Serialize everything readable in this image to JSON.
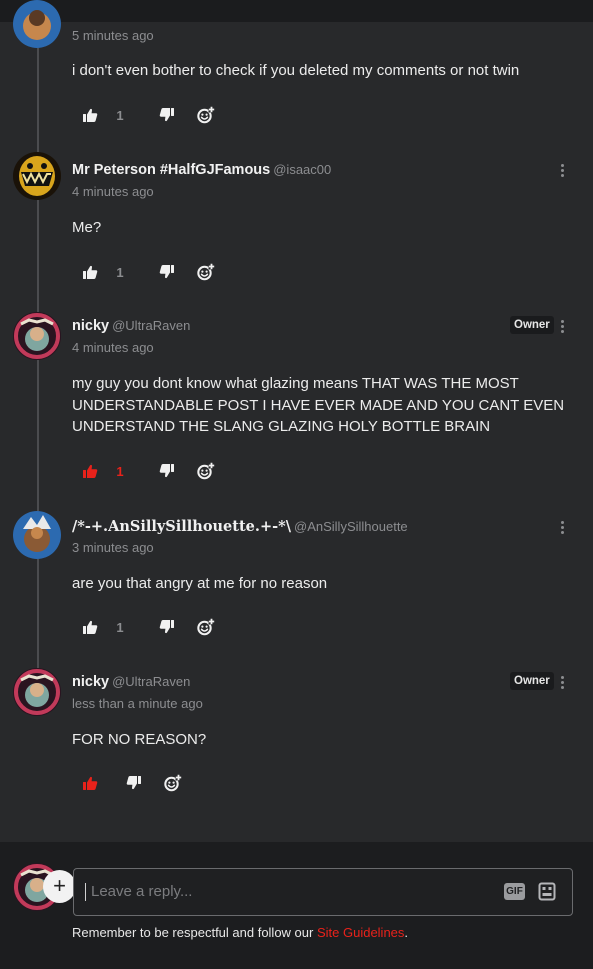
{
  "colors": {
    "background": "#28292b",
    "footer_background": "#1c1d1f",
    "accent_red": "#e8221b",
    "muted_text": "#8c8d90"
  },
  "comments": [
    {
      "name": "",
      "handle": "",
      "time": "5 minutes ago",
      "body": "i don't even bother to check if you deleted my comments or not twin",
      "likes": "1",
      "liked": false,
      "owner": false
    },
    {
      "name": "Mr Peterson #HalfGJFamous",
      "handle": "@isaac00",
      "time": "4 minutes ago",
      "body": "Me?",
      "likes": "1",
      "liked": false,
      "owner": false
    },
    {
      "name": "nicky",
      "handle": "@UltraRaven",
      "time": "4 minutes ago",
      "body": "my guy you dont know what glazing means THAT WAS THE MOST UNDERSTANDABLE POST I HAVE EVER MADE AND YOU CANT EVEN UNDERSTAND THE SLANG GLAZING HOLY BOTTLE BRAIN",
      "likes": "1",
      "liked": true,
      "owner": true,
      "owner_label": "Owner"
    },
    {
      "name": "/*-+.AnSillySillhouette.+-*\\",
      "handle": "@AnSillySillhouette",
      "time": "3 minutes ago",
      "body": "are you that angry at me for no reason",
      "likes": "1",
      "liked": false,
      "owner": false
    },
    {
      "name": "nicky",
      "handle": "@UltraRaven",
      "time": "less than a minute ago",
      "body": "FOR NO REASON?",
      "likes": "",
      "liked": true,
      "owner": true,
      "owner_label": "Owner"
    }
  ],
  "reply": {
    "placeholder": "Leave a reply...",
    "plus_symbol": "+",
    "gif_label": "GIF",
    "guidelines_prefix": "Remember to be respectful and follow our ",
    "guidelines_link": "Site Guidelines",
    "guidelines_suffix": "."
  },
  "icons": {
    "like": "thumbs-up-icon",
    "dislike": "thumbs-down-icon",
    "react": "add-emoji-icon",
    "more": "more-vertical-icon",
    "gif": "gif-icon",
    "emoji_picker": "emoji-picker-icon"
  }
}
